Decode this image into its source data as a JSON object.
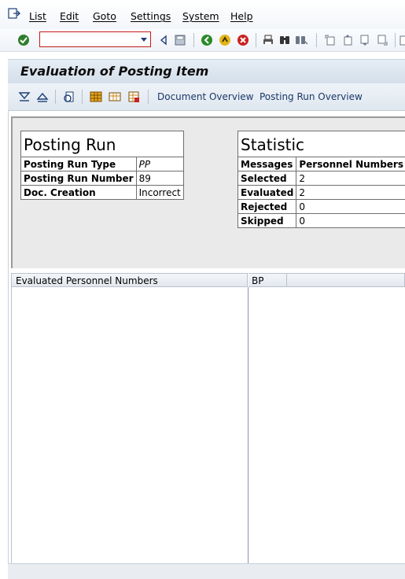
{
  "menu": {
    "items": [
      {
        "label": "List"
      },
      {
        "label": "Edit"
      },
      {
        "label": "Goto"
      },
      {
        "label": "Settings"
      },
      {
        "label": "System"
      },
      {
        "label": "Help"
      }
    ]
  },
  "toolbar": {
    "command_field": "",
    "icons": [
      "enter-icon",
      "back-icon",
      "save-icon",
      "back-green-icon",
      "exit-icon",
      "cancel-icon",
      "print-icon",
      "find-icon",
      "find-next-icon",
      "first-page-icon",
      "previous-page-icon",
      "next-page-icon",
      "last-page-icon"
    ]
  },
  "title": "Evaluation of Posting Item",
  "app_toolbar": {
    "document_overview": "Document Overview",
    "posting_run_overview": "Posting Run Overview"
  },
  "posting_run": {
    "header": "Posting Run",
    "rows": [
      {
        "label": "Posting Run Type",
        "value": "PP"
      },
      {
        "label": "Posting Run Number",
        "value": "89"
      },
      {
        "label": "Doc. Creation",
        "value": "Incorrect"
      }
    ]
  },
  "statistic": {
    "header": "Statistic",
    "col1": "Messages",
    "col2": "Personnel Numbers",
    "rows": [
      {
        "label": "Selected",
        "value": "2"
      },
      {
        "label": "Evaluated",
        "value": "2"
      },
      {
        "label": "Rejected",
        "value": "0"
      },
      {
        "label": "Skipped",
        "value": "0"
      }
    ]
  },
  "tree": {
    "left_header": "Evaluated Personnel Numbers",
    "right_header": "BP"
  },
  "colors": {
    "title_bg": "#d4dfea",
    "link": "#1a3868",
    "command_border": "#c51b1b",
    "panel_bg": "#eaeaea"
  }
}
